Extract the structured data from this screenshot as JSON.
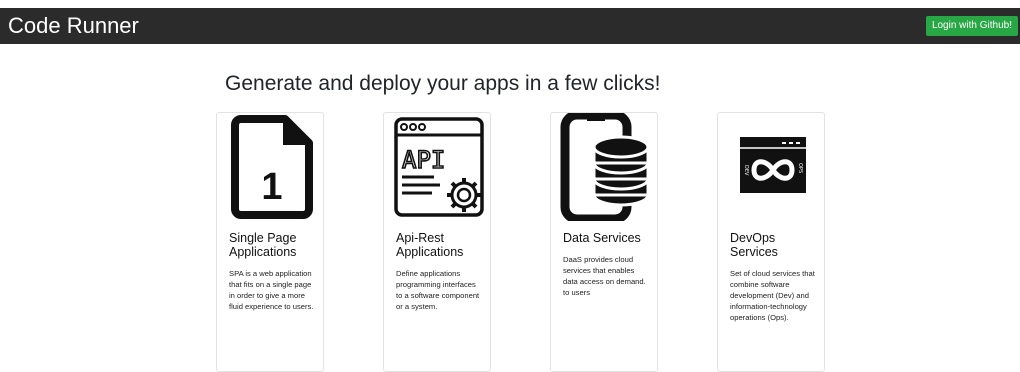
{
  "navbar": {
    "brand": "Code Runner",
    "login_label": "Login with Github!"
  },
  "headline": "Generate and deploy your apps in a few clicks!",
  "cards": [
    {
      "icon": "single-page-file-icon",
      "title": "Single Page Applications",
      "description": "SPA is a web application that fits on a single page in order to give a more fluid experience to users."
    },
    {
      "icon": "api-gear-icon",
      "title": "Api-Rest Applications",
      "description": "Define applications programming interfaces to a software component or a system."
    },
    {
      "icon": "phone-database-icon",
      "title": "Data Services",
      "description": "DaaS provides cloud services that enables data access on demand. to users"
    },
    {
      "icon": "devops-infinity-icon",
      "title": "DevOps Services",
      "description": "Set of cloud services that combine software development (Dev) and information-technology operations (Ops)."
    }
  ],
  "icon_text": {
    "page_number": "1",
    "api": "API",
    "dev": "DEV",
    "ops": "OPS"
  },
  "colors": {
    "navbar_bg": "#2b2b2b",
    "login_button_bg": "#28a745"
  }
}
